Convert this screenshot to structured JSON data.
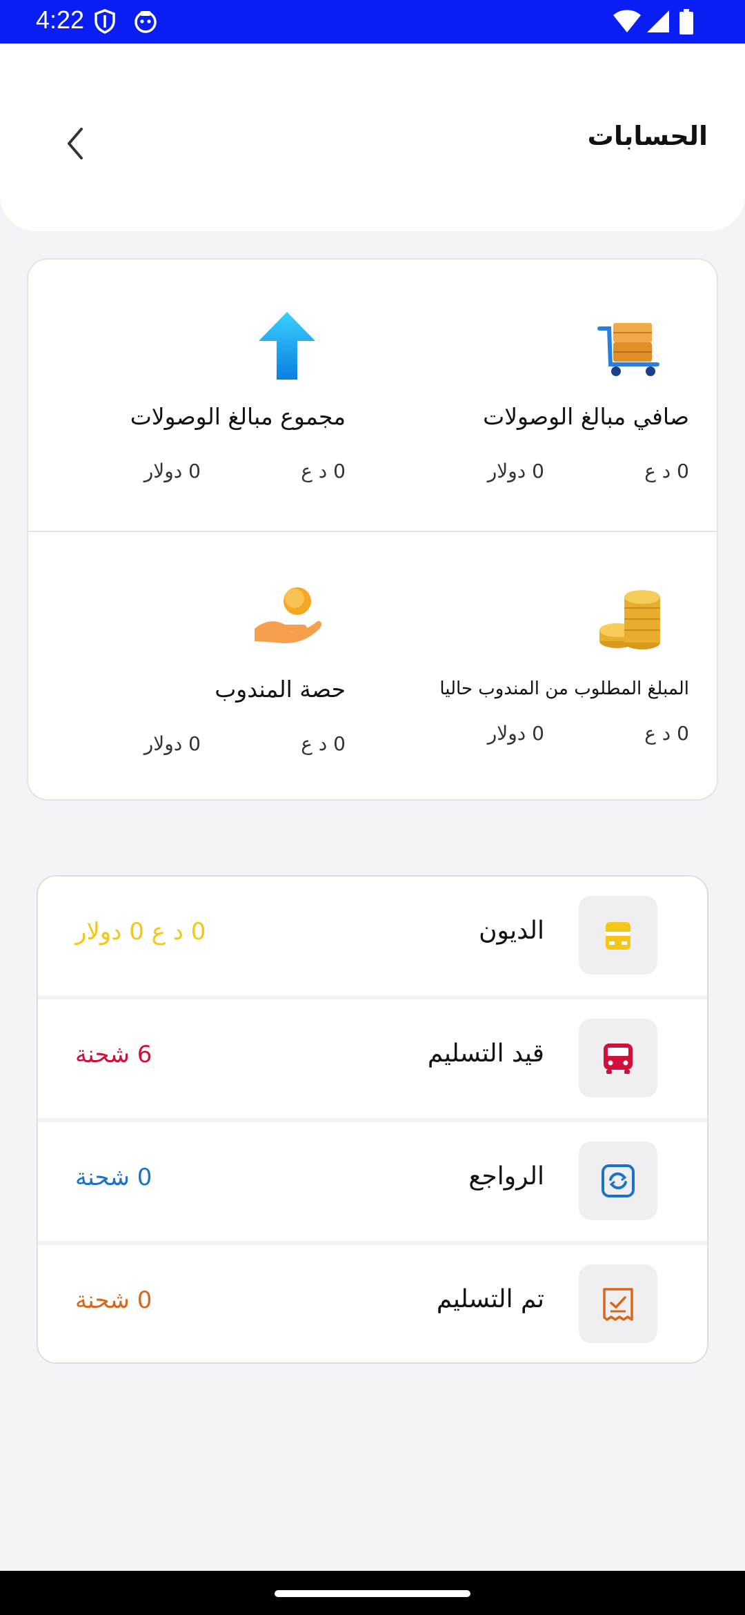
{
  "status_bar": {
    "time": "4:22"
  },
  "header": {
    "title": "الحسابات"
  },
  "summary": {
    "cells": [
      {
        "label": "صافي مبالغ الوصولات",
        "iqd": "0 د ع",
        "usd": "0  دولار",
        "icon": "cart-boxes-icon"
      },
      {
        "label": "مجموع مبالغ الوصولات",
        "iqd": "0 د ع",
        "usd": "0  دولار",
        "icon": "up-arrow-icon"
      },
      {
        "label": "المبلغ المطلوب من المندوب حاليا",
        "iqd": "0 د ع",
        "usd": "0  دولار",
        "icon": "coins-stack-icon"
      },
      {
        "label": "حصة المندوب",
        "iqd": "0 د ع",
        "usd": "0  دولار",
        "icon": "hand-coin-icon"
      }
    ]
  },
  "list": {
    "rows": [
      {
        "label": "الديون",
        "value": "0 د ع  0 دولار",
        "color": "#f5c518",
        "icon": "debt-icon"
      },
      {
        "label": "قيد التسليم",
        "value": "6 شحنة",
        "color": "#d0103a",
        "icon": "bus-icon"
      },
      {
        "label": "الرواجع",
        "value": "0 شحنة",
        "color": "#1a73c9",
        "icon": "refresh-icon"
      },
      {
        "label": "تم التسليم",
        "value": "0 شحنة",
        "color": "#d9661a",
        "icon": "receipt-check-icon"
      }
    ]
  }
}
